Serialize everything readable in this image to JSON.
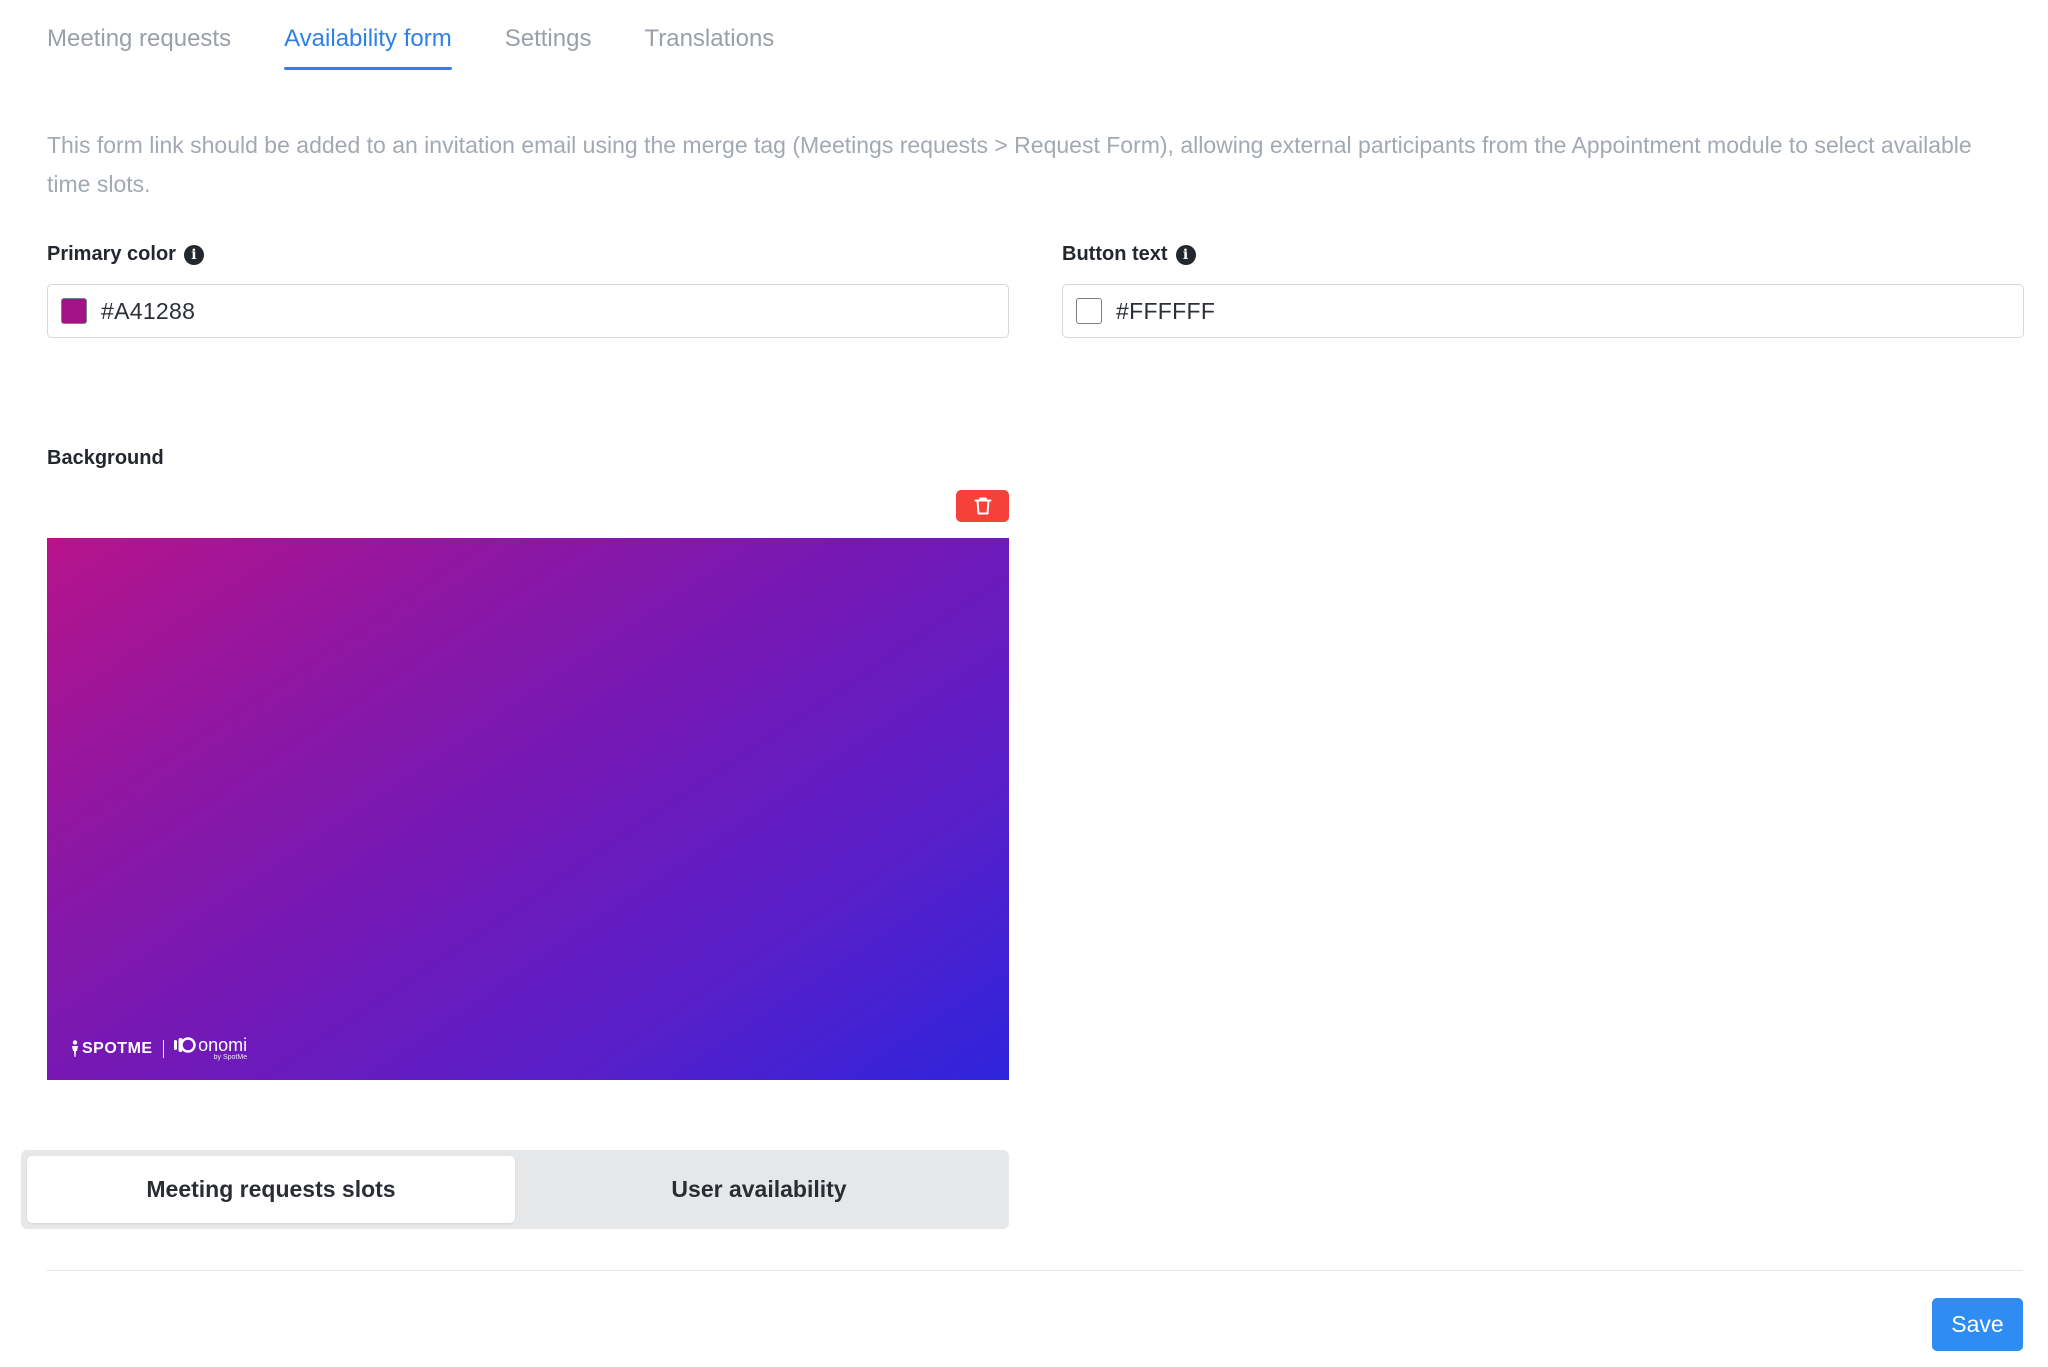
{
  "tabs": [
    {
      "label": "Meeting requests",
      "active": false
    },
    {
      "label": "Availability form",
      "active": true
    },
    {
      "label": "Settings",
      "active": false
    },
    {
      "label": "Translations",
      "active": false
    }
  ],
  "description": "This form link should be added to an invitation email using the merge tag (Meetings requests > Request Form), allowing external participants from the Appointment module to select available time slots.",
  "primary_color": {
    "label": "Primary color",
    "info_icon": "info-icon",
    "value": "#A41288",
    "swatch_color": "#A41288"
  },
  "button_text": {
    "label": "Button text",
    "info_icon": "info-icon",
    "value": "#FFFFFF",
    "swatch_color": "#FFFFFF"
  },
  "background": {
    "label": "Background",
    "delete_icon": "trash-icon",
    "delete_color": "#F5413A",
    "gradient_colors": [
      "#B7138B",
      "#2E24DC"
    ],
    "logo": {
      "spotme": "SPOTME",
      "onomi": "onomi",
      "onomi_sub": "by SpotMe"
    }
  },
  "segments": [
    {
      "label": "Meeting requests slots",
      "active": true
    },
    {
      "label": "User availability",
      "active": false
    }
  ],
  "save_label": "Save",
  "accent_color": "#2F80ED"
}
